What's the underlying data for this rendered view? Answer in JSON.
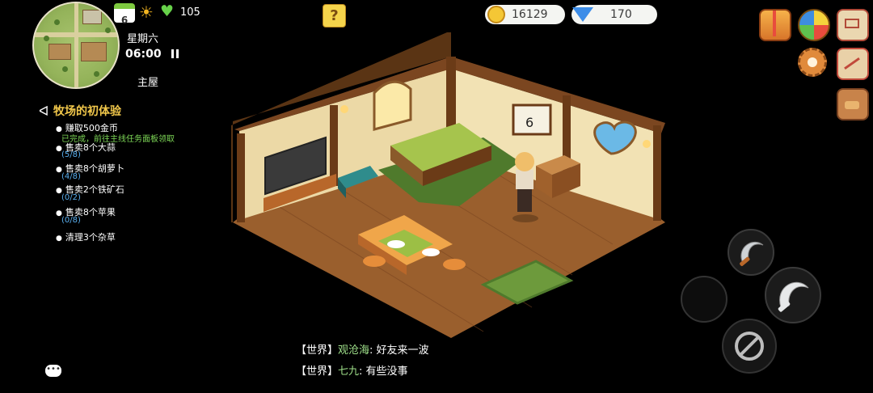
{
  "hud": {
    "day_number": "6",
    "energy": "105",
    "weekday": "星期六",
    "time": "06:00",
    "pause_icon": "pause-icon",
    "location": "主屋",
    "help_label": "?"
  },
  "currency": {
    "coins": "16129",
    "gems": "170"
  },
  "side_icons": [
    "gift-box-icon",
    "lucky-wheel-icon",
    "mail-scroll-icon",
    "settings-gear-icon",
    "map-icon",
    "backpack-icon"
  ],
  "quest": {
    "title": "牧场的初体验",
    "items": [
      {
        "label": "赚取500金币",
        "sub": "已完成，前往主线任务面板领取",
        "sub_color": "#7ed957"
      },
      {
        "label": "售卖8个大蒜",
        "sub": "(5/8)",
        "sub_color": "#5ab0f0"
      },
      {
        "label": "售卖8个胡萝卜",
        "sub": "(4/8)",
        "sub_color": "#5ab0f0"
      },
      {
        "label": "售卖2个铁矿石",
        "sub": "(0/2)",
        "sub_color": "#5ab0f0"
      },
      {
        "label": "售卖8个苹果",
        "sub": "(0/8)",
        "sub_color": "#5ab0f0"
      },
      {
        "label": "清理3个杂草",
        "sub": "",
        "sub_color": "#5ab0f0"
      }
    ]
  },
  "scene": {
    "calendar_day": "6"
  },
  "chat": [
    {
      "channel": "【世界】",
      "name": "观沧海",
      "message": "好友来一波"
    },
    {
      "channel": "【世界】",
      "name": "七九",
      "message": "有些没事"
    }
  ],
  "actions": {
    "tool_icon": "sickle-icon",
    "main_icon": "sickle-icon",
    "cancel_icon": "cancel-icon",
    "empty_slot": "empty-slot",
    "chat_icon": "chat-bubble-icon"
  },
  "colors": {
    "quest_title": "#f2c84b",
    "player_name": "#9fe08a",
    "progress": "#5ab0f0",
    "done": "#7ed957"
  }
}
